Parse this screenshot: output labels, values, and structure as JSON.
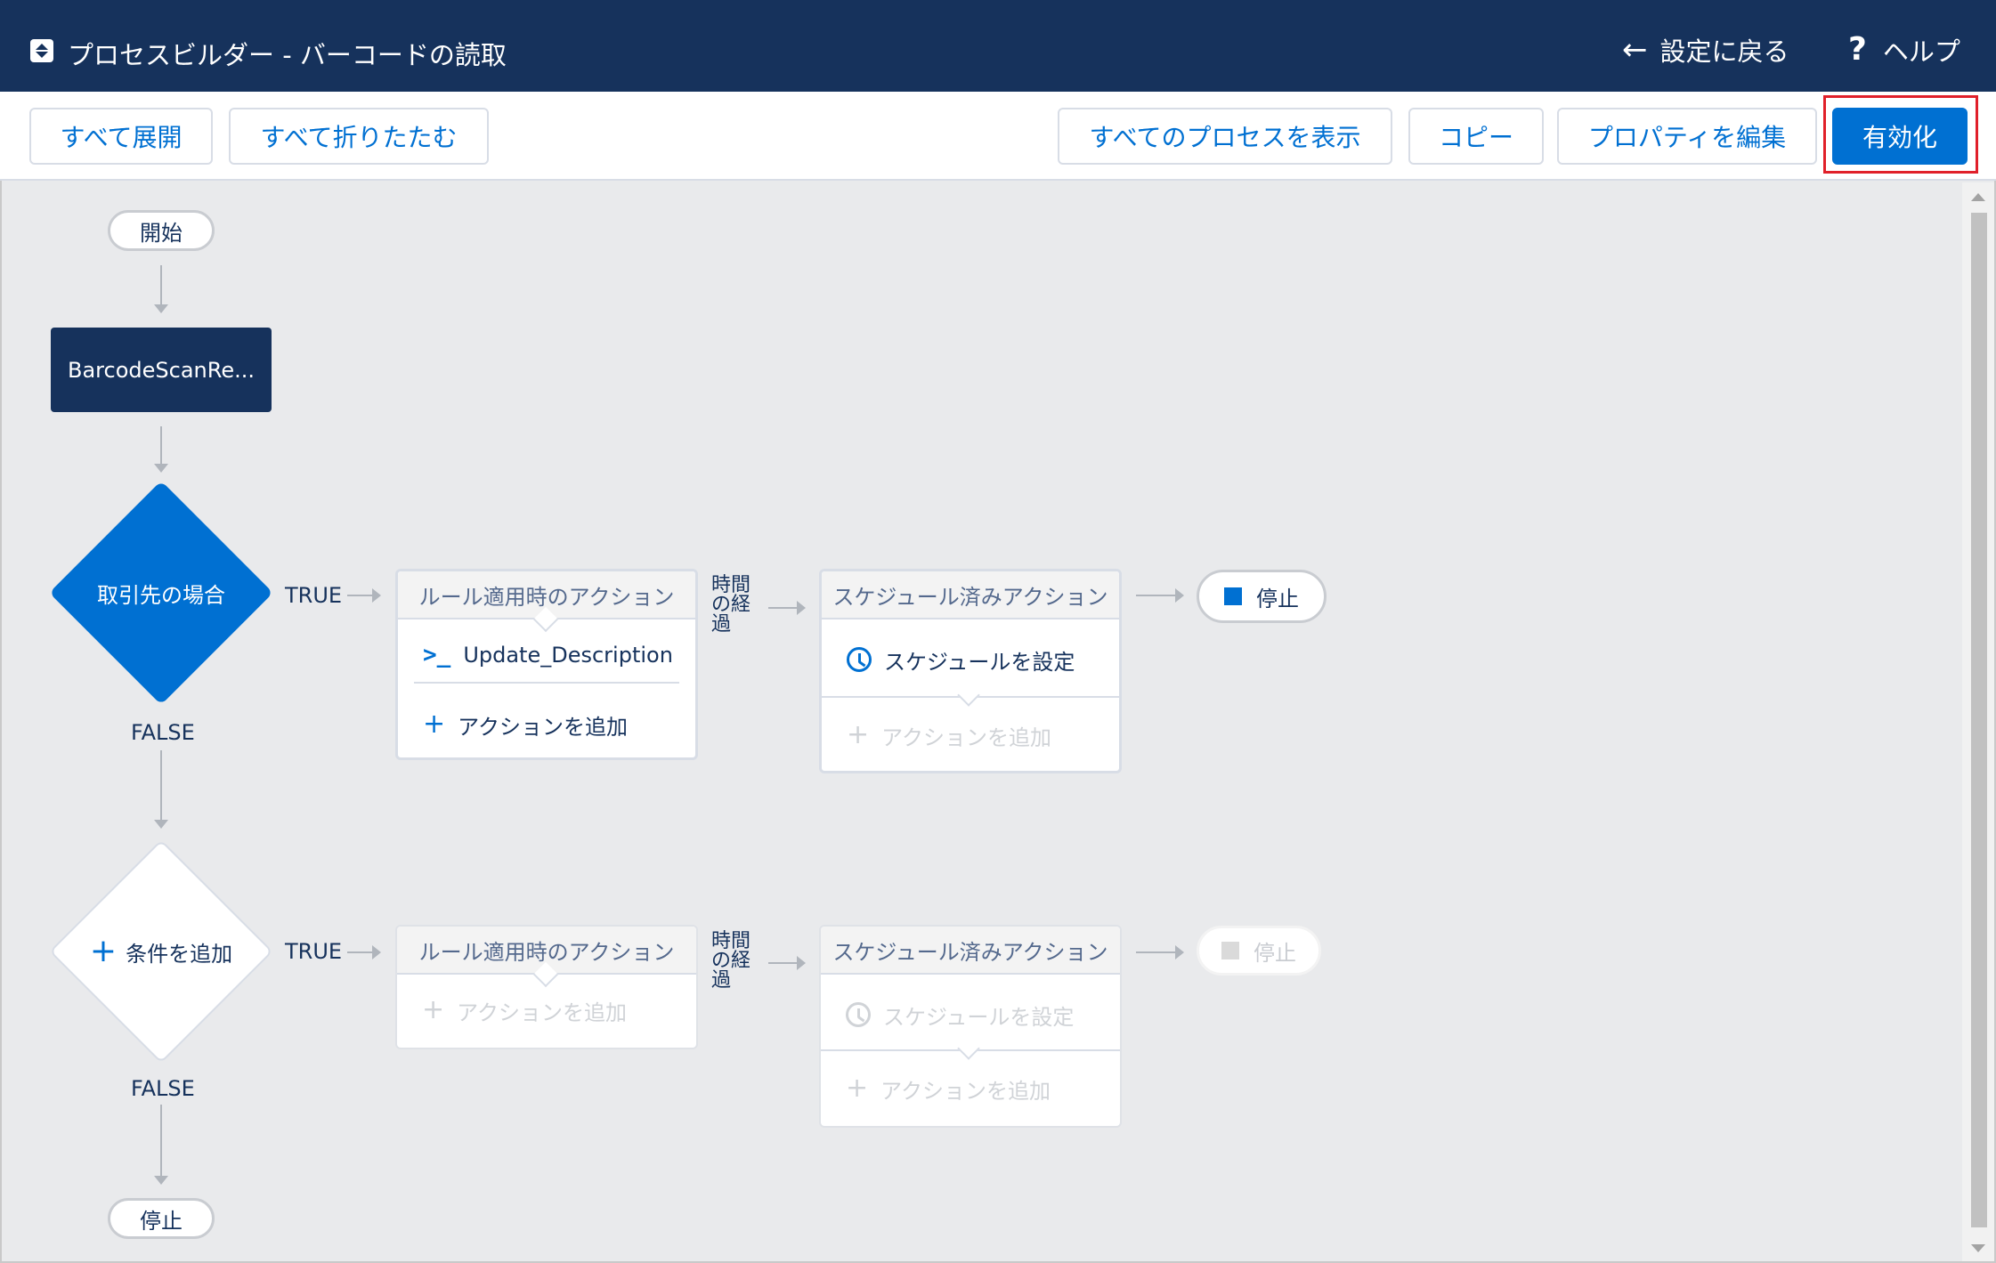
{
  "header": {
    "title": "プロセスビルダー - バーコードの読取",
    "back_label": "設定に戻る",
    "help_label": "ヘルプ"
  },
  "toolbar": {
    "expand_all": "すべて展開",
    "collapse_all": "すべて折りたたむ",
    "view_all_processes": "すべてのプロセスを表示",
    "copy": "コピー",
    "edit_properties": "プロパティを編集",
    "activate": "有効化"
  },
  "flow": {
    "start_label": "開始",
    "trigger_object": "BarcodeScanRe...",
    "end_label": "停止",
    "true_label": "TRUE",
    "false_label": "FALSE",
    "time_elapsed_label": [
      "時間",
      "の経",
      "過"
    ],
    "criteria": [
      {
        "name": "取引先の場合",
        "immediate_header": "ルール適用時のアクション",
        "immediate_actions": [
          "Update_Description"
        ],
        "add_action_label": "アクションを追加",
        "scheduled_header": "スケジュール済みアクション",
        "set_schedule_label": "スケジュールを設定",
        "scheduled_add_action_label": "アクションを追加",
        "stop_label": "停止"
      },
      {
        "name": "条件を追加",
        "immediate_header": "ルール適用時のアクション",
        "add_action_label": "アクションを追加",
        "scheduled_header": "スケジュール済みアクション",
        "set_schedule_label": "スケジュールを設定",
        "scheduled_add_action_label": "アクションを追加",
        "stop_label": "停止"
      }
    ]
  },
  "colors": {
    "header_bg": "#16325c",
    "primary": "#0070d2",
    "highlight_border": "#e0202a"
  }
}
